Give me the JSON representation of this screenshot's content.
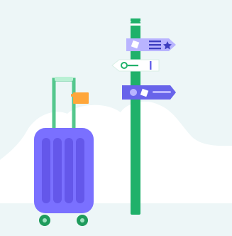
{
  "illustration": {
    "subject": "travel-suitcase-and-signpost",
    "colors": {
      "background": "#edf6f7",
      "hill": "#ffffff",
      "pole": "#1fb16a",
      "suitcase_body": "#7a70ff",
      "suitcase_stripe": "#6457ea",
      "suitcase_handle": "#54c78d",
      "luggage_tag": "#ffa63a",
      "sign_lavender": "#b9b4ff",
      "sign_white": "#ffffff",
      "sign_blue": "#6864ea",
      "wheel": "#1f9b5c"
    },
    "icons": [
      "suitcase-icon",
      "luggage-tag-icon",
      "signpost-icon",
      "list-icon",
      "star-icon",
      "key-icon",
      "circle-icon"
    ]
  }
}
